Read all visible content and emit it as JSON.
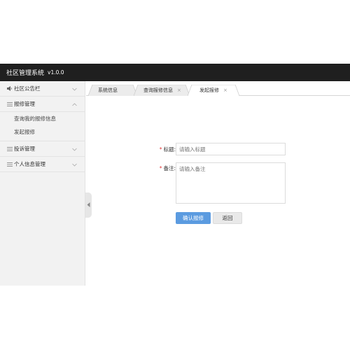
{
  "header": {
    "title": "社区管理系统",
    "version": "v1.0.0"
  },
  "sidebar": {
    "items": [
      {
        "label": "社区公告栏",
        "icon": "speaker-icon",
        "expanded": false
      },
      {
        "label": "报修管理",
        "icon": "list-icon",
        "expanded": true,
        "children": [
          {
            "label": "查询我的报修信息"
          },
          {
            "label": "发起报修"
          }
        ]
      },
      {
        "label": "投诉管理",
        "icon": "list-icon",
        "expanded": false
      },
      {
        "label": "个人信息管理",
        "icon": "list-icon",
        "expanded": false
      }
    ]
  },
  "tabs": [
    {
      "label": "系统信息",
      "closable": false,
      "active": false
    },
    {
      "label": "查询报修信息",
      "closable": true,
      "active": false
    },
    {
      "label": "发起报修",
      "closable": true,
      "active": true
    }
  ],
  "close_glyph": "×",
  "form": {
    "title_label": "标题:",
    "title_placeholder": "请输入标题",
    "remark_label": "备注:",
    "remark_placeholder": "请输入备注",
    "required_mark": "*",
    "submit_label": "确认报修",
    "back_label": "返回"
  },
  "colors": {
    "topbar": "#1f1f1f",
    "primary": "#5b9be0",
    "required": "#e23b3b"
  }
}
